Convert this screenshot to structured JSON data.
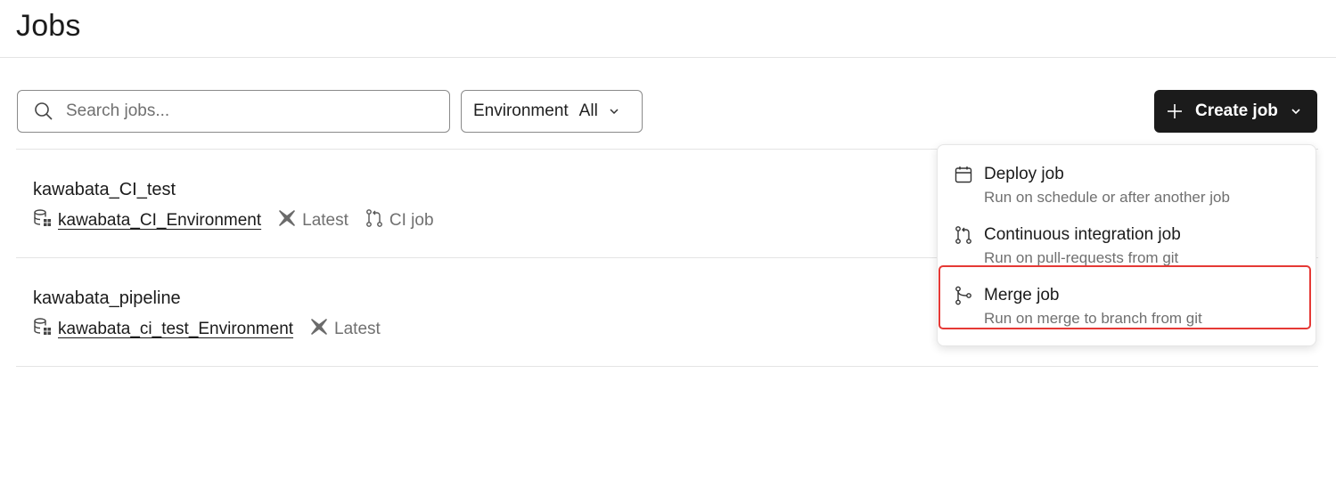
{
  "page": {
    "title": "Jobs"
  },
  "toolbar": {
    "search_placeholder": "Search jobs...",
    "env_filter_label": "Environment",
    "env_filter_value": "All",
    "create_label": "Create job"
  },
  "jobs": [
    {
      "name": "kawabata_CI_test",
      "environment": "kawabata_CI_Environment",
      "version": "Latest",
      "type": "CI job"
    },
    {
      "name": "kawabata_pipeline",
      "environment": "kawabata_ci_test_Environment",
      "version": "Latest"
    }
  ],
  "create_menu": {
    "items": [
      {
        "title": "Deploy job",
        "description": "Run on schedule or after another job",
        "icon": "calendar-icon"
      },
      {
        "title": "Continuous integration job",
        "description": "Run on pull-requests from git",
        "icon": "pull-request-icon"
      },
      {
        "title": "Merge job",
        "description": "Run on merge to branch from git",
        "icon": "git-merge-icon"
      }
    ],
    "highlight_color": "#e53935"
  },
  "colors": {
    "primary_button": "#1b1b1b",
    "muted_text": "#707070"
  }
}
